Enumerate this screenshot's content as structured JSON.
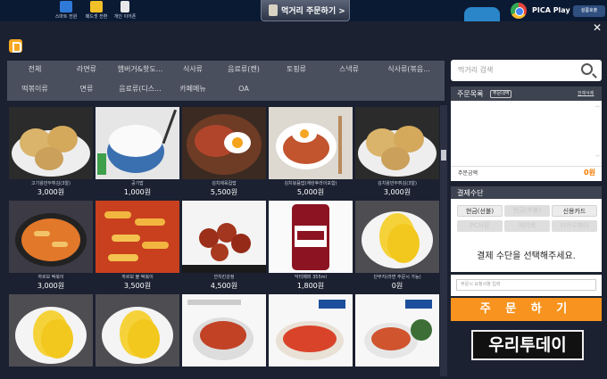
{
  "taskbar": {
    "apps": [
      {
        "label": "스마트 전원",
        "color": "#2f79d9"
      },
      {
        "label": "패드셋 전환",
        "color": "#f2c028"
      },
      {
        "label": "개인 이어폰",
        "color": "#e8e8e8"
      }
    ],
    "order_tab": "먹거리 주문하기 >",
    "browser_label": "PICA Play",
    "sys_label": "설룸호출"
  },
  "categories": [
    "전체",
    "라면류",
    "햄버거&핫도...",
    "식사류",
    "음료류(캔)",
    "토핑류",
    "스낵류",
    "식사류(볶음...",
    "떡볶이류",
    "면류",
    "음료류(디스...",
    "카페메뉴",
    "OA"
  ],
  "products": [
    {
      "name": "고기왕만두튀김(3알)",
      "price": "3,000원"
    },
    {
      "name": "공기밥",
      "price": "1,000원"
    },
    {
      "name": "김치제육컵밥",
      "price": "5,500원"
    },
    {
      "name": "김치볶음밥(계란후라이포함)",
      "price": "5,000원"
    },
    {
      "name": "김치왕만두튀김(3알)",
      "price": "3,000원"
    },
    {
      "name": "까르보 떡볶이",
      "price": "3,000원"
    },
    {
      "name": "까르보 불 떡볶이",
      "price": "3,500원"
    },
    {
      "name": "깐치킨강정",
      "price": "4,500원"
    },
    {
      "name": "닥터페퍼 355ml",
      "price": "1,800원"
    },
    {
      "name": "단무지(라면 주문시 가능)",
      "price": "0원"
    },
    {
      "name": "",
      "price": ""
    },
    {
      "name": "",
      "price": ""
    },
    {
      "name": "",
      "price": ""
    },
    {
      "name": "",
      "price": ""
    },
    {
      "name": "",
      "price": ""
    }
  ],
  "search": {
    "placeholder": "먹거리 검색"
  },
  "order_list": {
    "title": "주문목록",
    "badge": "주문내역",
    "clear_all": "전체삭제",
    "total_label": "주문금액",
    "total_value": "0원"
  },
  "payment": {
    "title": "결제수단",
    "methods": [
      "현금(선불)",
      "현금(후불)",
      "신용카드",
      "PC사장",
      "페이북",
      "카카오페이"
    ],
    "prompt": "결제 수단을 선택해주세요."
  },
  "request": {
    "placeholder": "주문시 요청사항 입력"
  },
  "order_button": "주 문 하 기",
  "watermark": "우리투데이",
  "colors": {
    "accent": "#f7931e",
    "panel_header": "#3d4350",
    "background": "#1b2131"
  }
}
